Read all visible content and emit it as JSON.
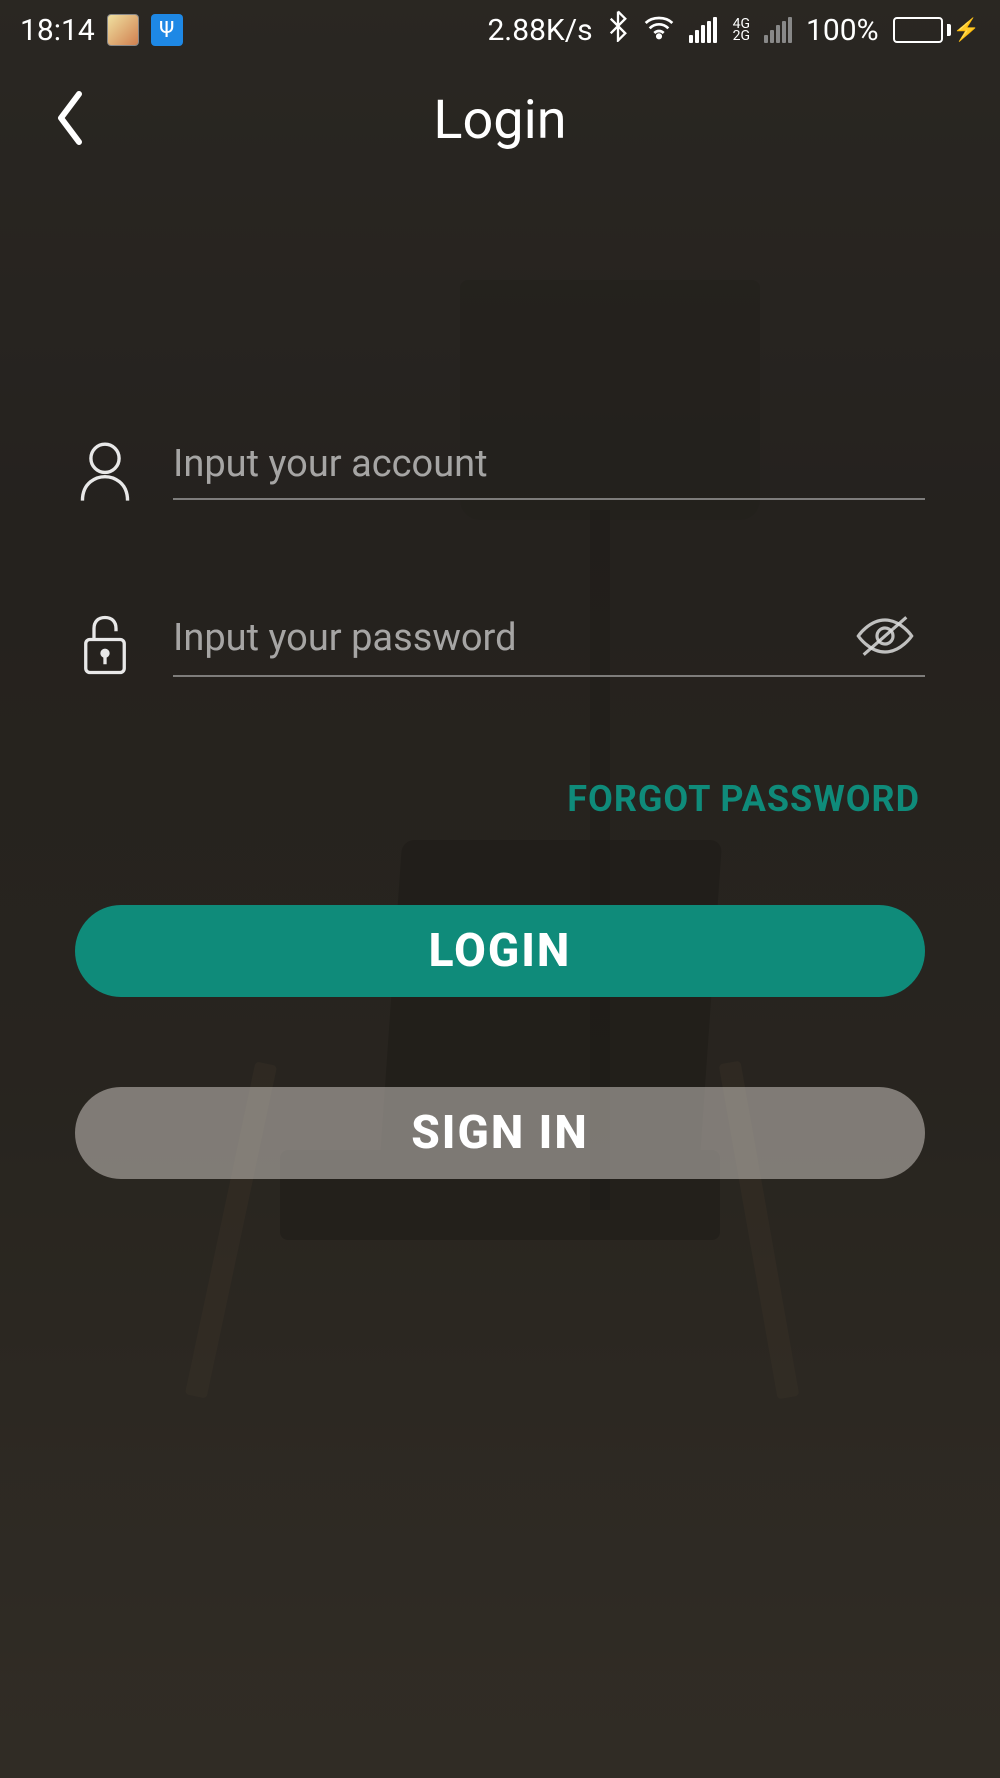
{
  "status_bar": {
    "time": "18:14",
    "usb_glyph": "Ψ",
    "net_speed": "2.88K/s",
    "signal_label_top": "4G",
    "signal_label_bottom": "2G",
    "battery_pct": "100%"
  },
  "header": {
    "title": "Login"
  },
  "form": {
    "account_placeholder": "Input your account",
    "password_placeholder": "Input your password",
    "forgot_label": "FORGOT PASSWORD",
    "login_button": "LOGIN",
    "signin_button": "SIGN IN"
  },
  "colors": {
    "accent": "#0f8b7a"
  }
}
